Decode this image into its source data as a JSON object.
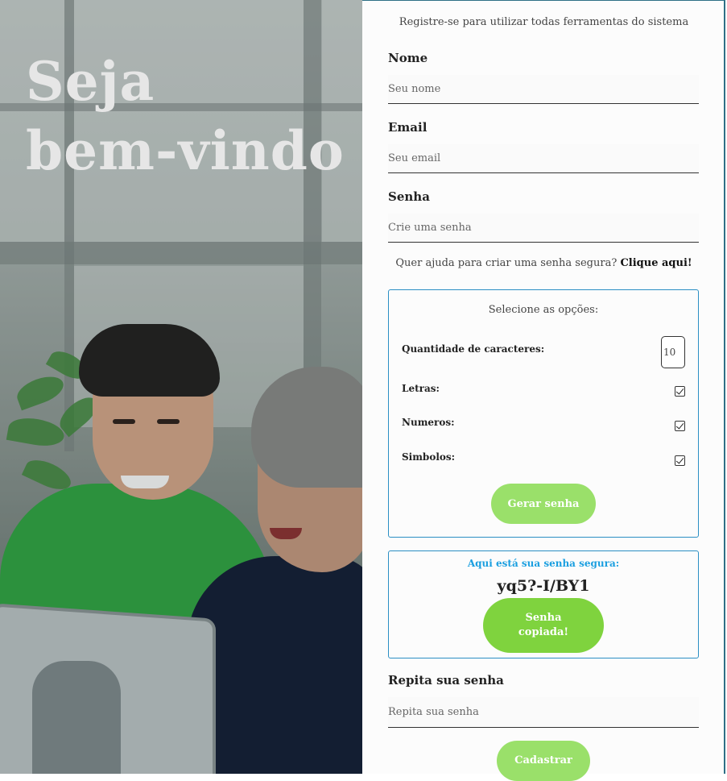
{
  "hero": {
    "title_line1": "Seja",
    "title_line2": "bem-vindo"
  },
  "form": {
    "subtitle": "Registre-se para utilizar todas ferramentas do sistema",
    "name_label": "Nome",
    "name_placeholder": "Seu nome",
    "email_label": "Email",
    "email_placeholder": "Seu email",
    "password_label": "Senha",
    "password_placeholder": "Crie uma senha",
    "help_text": "Quer ajuda para criar uma senha segura?",
    "help_link": "Clique aqui!",
    "repeat_label": "Repita sua senha",
    "repeat_placeholder": "Repita sua senha",
    "submit_label": "Cadastrar"
  },
  "generator": {
    "title": "Selecione as opções:",
    "length_label": "Quantidade de caracteres:",
    "length_value": "10",
    "letters_label": "Letras:",
    "letters_checked": true,
    "numbers_label": "Numeros:",
    "numbers_checked": true,
    "symbols_label": "Simbolos:",
    "symbols_checked": true,
    "generate_label": "Gerar senha"
  },
  "result": {
    "title": "Aqui está sua senha segura:",
    "password": "yq5?-I/BY1",
    "copy_label": "Senha copiada!"
  },
  "colors": {
    "accent_green": "#9ae06a",
    "copy_green": "#7fd33e",
    "border_blue": "#2b8fc4",
    "result_title_blue": "#1a9fe0"
  }
}
